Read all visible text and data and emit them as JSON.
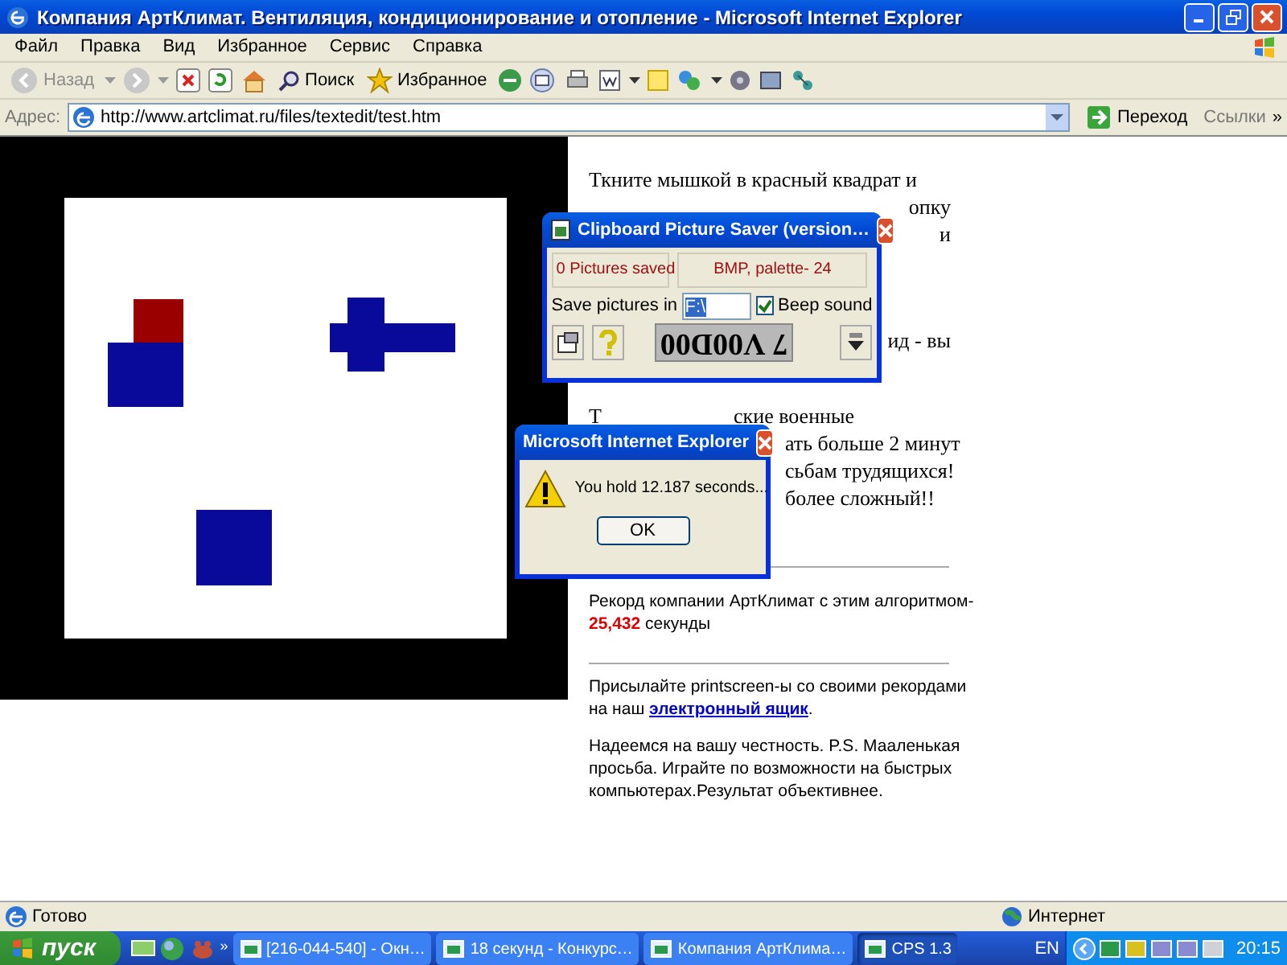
{
  "window": {
    "title": "Компания АртКлимат. Вентиляция, кондиционирование и отопление - Microsoft Internet Explorer"
  },
  "menu": [
    "Файл",
    "Правка",
    "Вид",
    "Избранное",
    "Сервис",
    "Справка"
  ],
  "toolbar": {
    "back": {
      "label": "Назад",
      "disabled": true
    },
    "search": "Поиск",
    "favorites": "Избранное"
  },
  "address": {
    "label": "Адрес:",
    "url": "http://www.artclimat.ru/files/textedit/test.htm",
    "go": "Переход",
    "links": "Ссылки",
    "more": "»"
  },
  "article": {
    "paragraphs": [
      {
        "lines": [
          {
            "kind": "full",
            "text": "Ткните мышкой в красный квадрат и"
          },
          {
            "kind": "right_tail",
            "text": "опку"
          },
          {
            "kind": "right_tail",
            "text": "и"
          }
        ]
      },
      {
        "lines": [
          {
            "kind": "right_tail",
            "text": "ид - вы"
          }
        ]
      },
      {
        "lines": [
          {
            "kind": "split",
            "head": "Т",
            "text": "ские военные"
          },
          {
            "kind": "left_tail",
            "text": "ать больше 2 минут"
          },
          {
            "kind": "left_tail",
            "text": "сьбам трудящихся!"
          },
          {
            "kind": "left_tail",
            "text": "более сложный!!"
          }
        ]
      }
    ]
  },
  "record": {
    "text": "Рекорд компании АртКлимат с этим алгоритмом-",
    "value": "25,432",
    "unit": "секунды"
  },
  "contact": {
    "text": "Присылайте printscreen-ы со своими рекордами на наш",
    "link": "электронный ящик",
    "end": "."
  },
  "note": "Надеемся на вашу честность. P.S. Мааленькая просьба. Играйте по возможности на быстрых компьютерах.Результат объективнее.",
  "saver": {
    "title": "Clipboard Picture Saver (version…",
    "count_button": "0 Pictures saved",
    "format_button": "BMP, palette- 24",
    "folder_label": "Save pictures in",
    "folder_value": "F:\\",
    "beep": {
      "label": "Beep sound",
      "checked": true
    },
    "display": "7 V00D00"
  },
  "alert": {
    "title": "Microsoft Internet Explorer",
    "message": "You hold 12.187 seconds...",
    "ok": "OK"
  },
  "status_bar": {
    "text": "Готово",
    "zone": "Интернет"
  },
  "taskbar": {
    "start": "пуск",
    "more": "»",
    "tasks": [
      {
        "label": "[216-044-540] - Окн…",
        "selected": false
      },
      {
        "label": "18 секунд - Конкурс…",
        "selected": false
      },
      {
        "label": "Компания АртКлима…",
        "selected": false
      },
      {
        "label": "CPS 1.3",
        "selected": true
      }
    ],
    "language": "EN",
    "clock": "20:15"
  }
}
